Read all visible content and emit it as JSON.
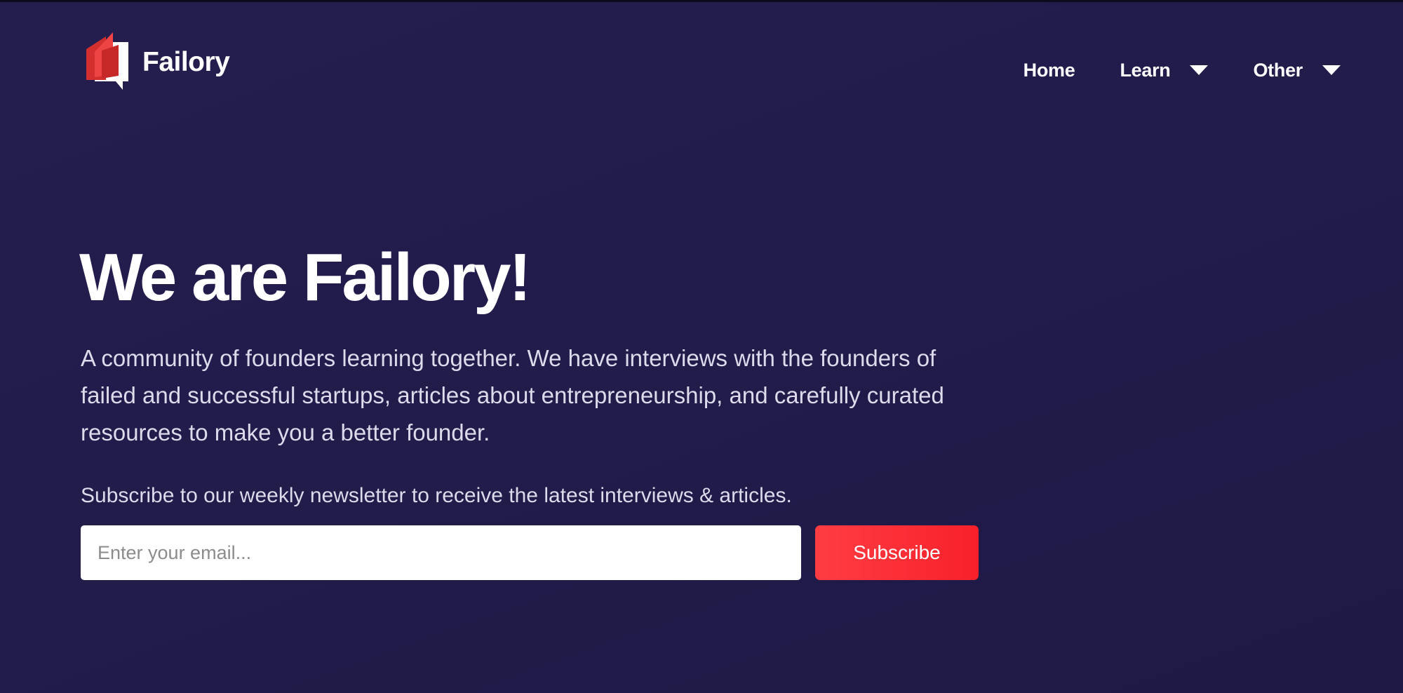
{
  "header": {
    "logo_text": "Failory",
    "logo_icon": "failory-book-logo-icon",
    "nav": [
      {
        "label": "Home",
        "has_dropdown": false
      },
      {
        "label": "Learn",
        "has_dropdown": true
      },
      {
        "label": "Other",
        "has_dropdown": true
      }
    ]
  },
  "hero": {
    "title": "We are Failory!",
    "description": "A community of founders learning together. We have interviews with the founders of failed and successful startups, articles about entrepreneurship, and carefully curated resources to make you a better founder.",
    "subscribe_text": "Subscribe to our weekly newsletter to receive the latest interviews & articles.",
    "email_placeholder": "Enter your email...",
    "email_value": "",
    "subscribe_label": "Subscribe"
  },
  "colors": {
    "background": "#221c4b",
    "accent": "#f8202a",
    "logo_red": "#e53935"
  }
}
